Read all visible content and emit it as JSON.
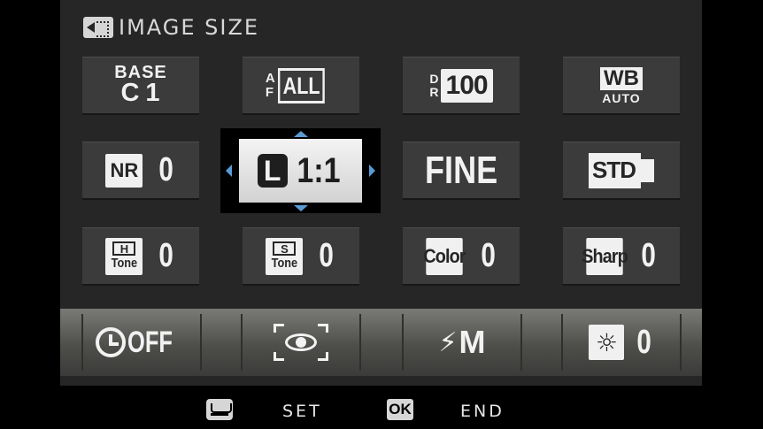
{
  "menu": {
    "title": "IMAGE SIZE",
    "title_icon": "image-size-icon"
  },
  "grid": {
    "row1": {
      "base_line1": "BASE",
      "base_line2": "C1",
      "af_stack": [
        "A",
        "F"
      ],
      "af_value": "ALL",
      "dr_stack": [
        "D",
        "R"
      ],
      "dr_value": "100",
      "wb_top": "WB",
      "wb_bottom": "AUTO"
    },
    "row2": {
      "nr_label": "NR",
      "nr_value": "0",
      "image_size_letter": "L",
      "image_size_ratio": "1:1",
      "image_quality": "FINE",
      "film_sim": "STD"
    },
    "row3": {
      "h_tone_box": "H",
      "h_tone_label": "Tone",
      "h_tone_value": "0",
      "s_tone_box": "S",
      "s_tone_label": "Tone",
      "s_tone_value": "0",
      "color_label": "Color",
      "color_value": "0",
      "sharp_label": "Sharp",
      "sharp_value": "0"
    }
  },
  "bottom_bar": {
    "self_timer_value": "OFF",
    "self_timer_icon": "self-timer-icon",
    "face_detect_icon": "face-detection-icon",
    "flash_icon": "flash-bolt-icon",
    "flash_mode": "M",
    "brightness_icon": "brightness-icon",
    "brightness_value": "0"
  },
  "footer": {
    "set_icon": "tray-icon",
    "set_label": "SET",
    "ok_badge": "OK",
    "end_label": "END"
  },
  "colors": {
    "selection_arrows": "#5b9bd5",
    "panel_background": "#262626",
    "tile_background": "#3b3b3b"
  }
}
